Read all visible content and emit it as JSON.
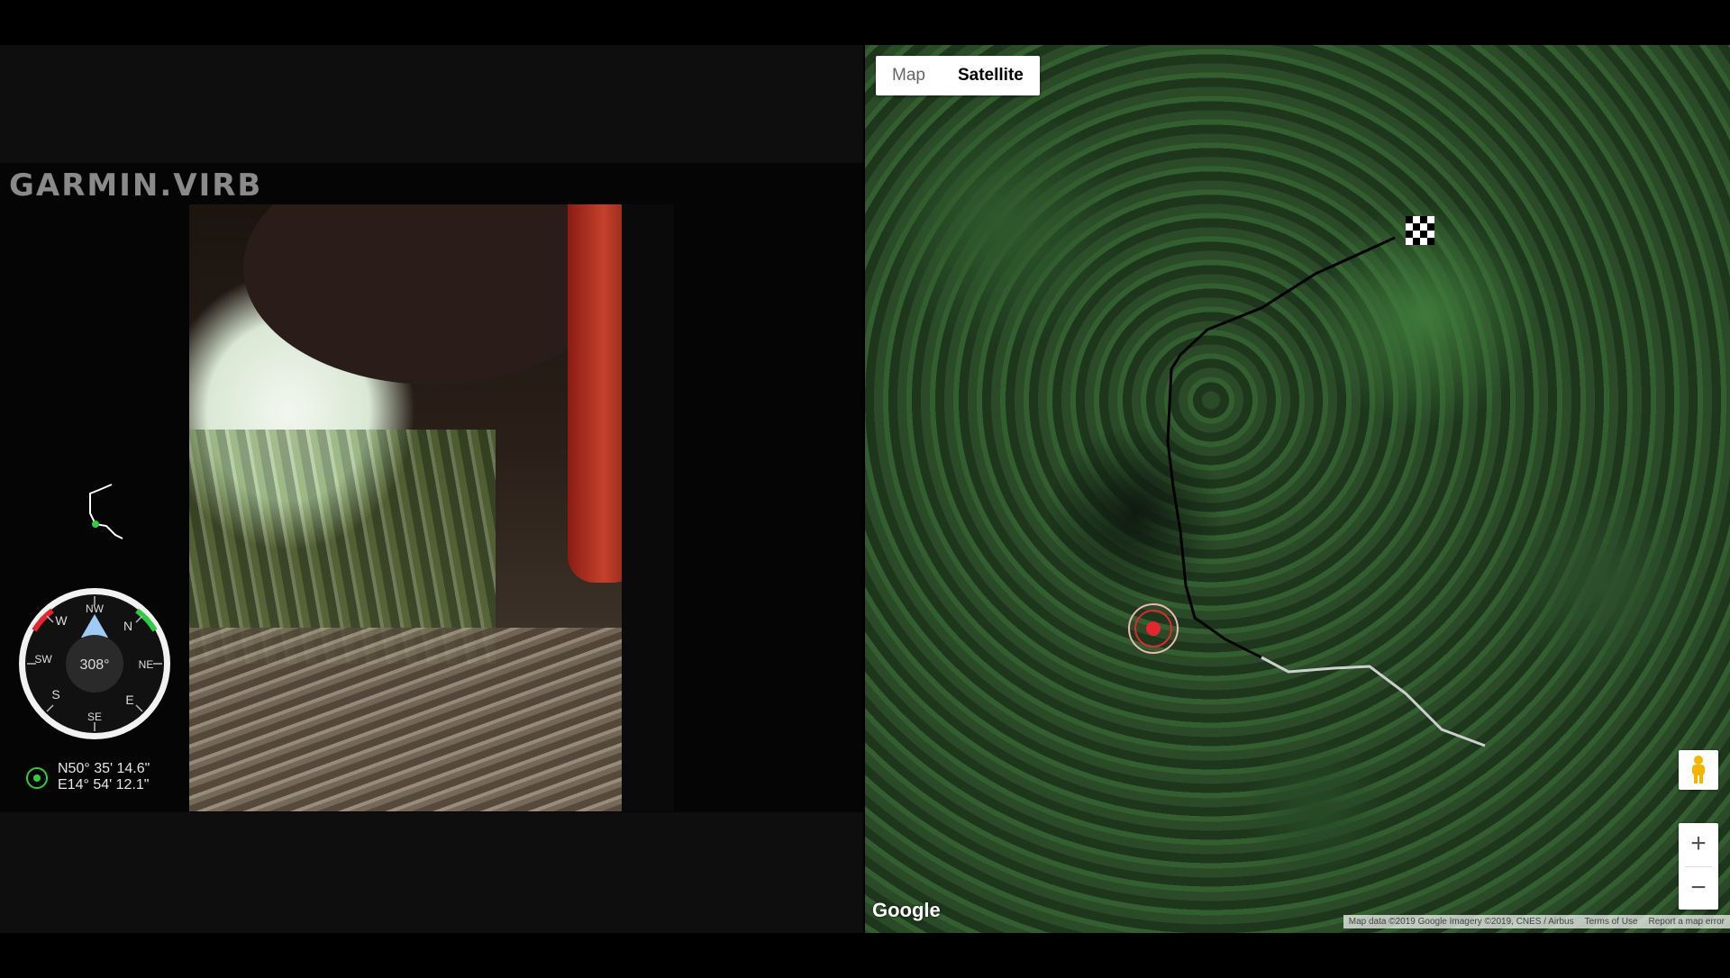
{
  "video": {
    "brand": "GARMIN.VIRB",
    "compass": {
      "heading": "308°",
      "labels": [
        "NW",
        "W",
        "SW",
        "S",
        "SE",
        "E",
        "NE",
        "N"
      ]
    },
    "coordinates": {
      "lat": "N50° 35' 14.6\"",
      "lon": "E14° 54' 12.1\""
    }
  },
  "map": {
    "tabs": [
      {
        "label": "Map",
        "active": false
      },
      {
        "label": "Satellite",
        "active": true
      }
    ],
    "zoom_in": "+",
    "zoom_out": "−",
    "google": "Google",
    "attribution": [
      "Map data ©2019 Google Imagery ©2019, CNES / Airbus",
      "Terms of Use",
      "Report a map error"
    ],
    "colors": {
      "track": "#000000",
      "track_ahead": "#cfcfcf",
      "marker": "#e3262f"
    }
  }
}
